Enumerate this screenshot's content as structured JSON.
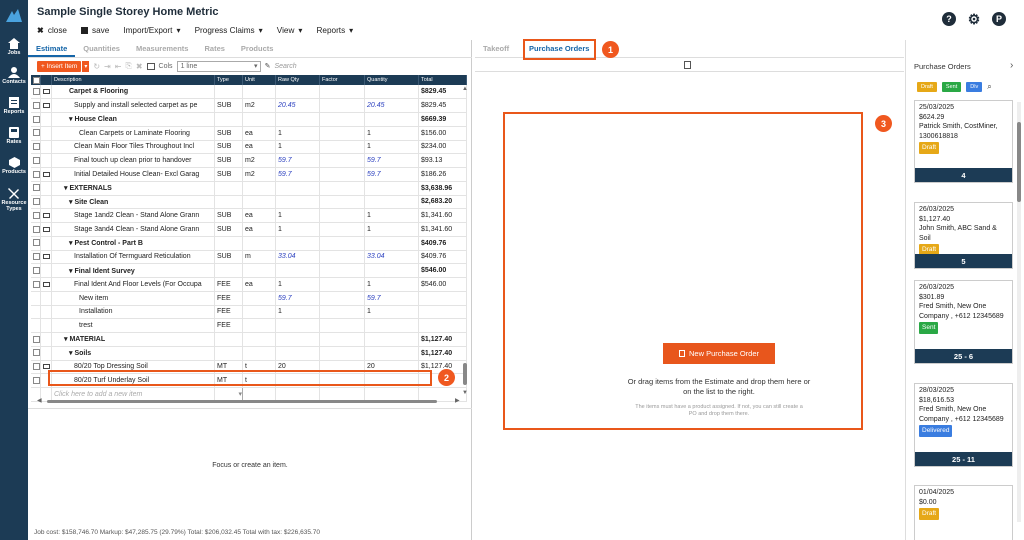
{
  "app": {
    "title": "Sample Single Storey Home Metric"
  },
  "menu": {
    "close": "close",
    "save": "save",
    "import_export": "Import/Export",
    "progress_claims": "Progress Claims",
    "view": "View",
    "reports": "Reports"
  },
  "header_icons": {
    "help": "?",
    "profile": "P"
  },
  "nav": [
    {
      "label": "Jobs",
      "icon": "home-icon"
    },
    {
      "label": "Contacts",
      "icon": "person-icon"
    },
    {
      "label": "Reports",
      "icon": "report-icon"
    },
    {
      "label": "Rates",
      "icon": "rates-icon"
    },
    {
      "label": "Products",
      "icon": "cube-icon"
    },
    {
      "label": "Resource Types",
      "icon": "tools-icon"
    }
  ],
  "left_tabs": [
    "Estimate",
    "Quantities",
    "Measurements",
    "Rates",
    "Products"
  ],
  "toolbar": {
    "insert": "+ Insert Item",
    "cols": "Cols",
    "line_select": "1 line",
    "search_placeholder": "Search"
  },
  "grid": {
    "columns": [
      "Description",
      "Type",
      "Unit",
      "Raw Qty",
      "Factor",
      "Quantity",
      "Total"
    ],
    "rows": [
      {
        "cb": true,
        "mail": true,
        "desc": "Carpet & Flooring",
        "type": "",
        "unit": "",
        "raw": "",
        "factor": "",
        "qty": "",
        "total": "$829.45",
        "bold": true,
        "ind": 3
      },
      {
        "cb": true,
        "mail": true,
        "desc": "Supply and install selected carpet as pe",
        "type": "SUB",
        "unit": "m2",
        "raw": "20.45",
        "factor": "",
        "qty": "20.45",
        "total": "$829.45",
        "ind": 4,
        "it": true
      },
      {
        "cb": true,
        "mail": false,
        "desc": "▾ House Clean",
        "type": "",
        "unit": "",
        "raw": "",
        "factor": "",
        "qty": "",
        "total": "$669.39",
        "bold": true,
        "ind": 3
      },
      {
        "cb": true,
        "mail": false,
        "desc": "Clean Carpets or Laminate Flooring",
        "type": "SUB",
        "unit": "ea",
        "raw": "1",
        "factor": "",
        "qty": "1",
        "total": "$156.00",
        "ind": 5
      },
      {
        "cb": true,
        "mail": false,
        "desc": "Clean Main Floor Tiles Throughout Incl",
        "type": "SUB",
        "unit": "ea",
        "raw": "1",
        "factor": "",
        "qty": "1",
        "total": "$234.00",
        "ind": 4
      },
      {
        "cb": true,
        "mail": false,
        "desc": "Final touch up clean prior to handover",
        "type": "SUB",
        "unit": "m2",
        "raw": "59.7",
        "factor": "",
        "qty": "59.7",
        "total": "$93.13",
        "ind": 4,
        "it": true
      },
      {
        "cb": true,
        "mail": true,
        "desc": "Initial Detailed House Clean- Excl Garag",
        "type": "SUB",
        "unit": "m2",
        "raw": "59.7",
        "factor": "",
        "qty": "59.7",
        "total": "$186.26",
        "ind": 4,
        "it": true
      },
      {
        "cb": true,
        "mail": false,
        "desc": "▾ EXTERNALS",
        "type": "",
        "unit": "",
        "raw": "",
        "factor": "",
        "qty": "",
        "total": "$3,638.96",
        "bold": true,
        "ind": 2
      },
      {
        "cb": true,
        "mail": false,
        "desc": "▾ Site Clean",
        "type": "",
        "unit": "",
        "raw": "",
        "factor": "",
        "qty": "",
        "total": "$2,683.20",
        "bold": true,
        "ind": 3
      },
      {
        "cb": true,
        "mail": true,
        "desc": "Stage 1and2 Clean - Stand Alone Grann",
        "type": "SUB",
        "unit": "ea",
        "raw": "1",
        "factor": "",
        "qty": "1",
        "total": "$1,341.60",
        "ind": 4
      },
      {
        "cb": true,
        "mail": true,
        "desc": "Stage 3and4 Clean - Stand Alone Grann",
        "type": "SUB",
        "unit": "ea",
        "raw": "1",
        "factor": "",
        "qty": "1",
        "total": "$1,341.60",
        "ind": 4
      },
      {
        "cb": true,
        "mail": false,
        "desc": "▾ Pest Control - Part B",
        "type": "",
        "unit": "",
        "raw": "",
        "factor": "",
        "qty": "",
        "total": "$409.76",
        "bold": true,
        "ind": 3
      },
      {
        "cb": true,
        "mail": true,
        "desc": "Installation Of Termguard Reticulation",
        "type": "SUB",
        "unit": "m",
        "raw": "33.04",
        "factor": "",
        "qty": "33.04",
        "total": "$409.76",
        "ind": 4,
        "it": true
      },
      {
        "cb": true,
        "mail": false,
        "desc": "▾ Final Ident Survey",
        "type": "",
        "unit": "",
        "raw": "",
        "factor": "",
        "qty": "",
        "total": "$546.00",
        "bold": true,
        "ind": 3
      },
      {
        "cb": true,
        "mail": true,
        "desc": "Final Ident And Floor Levels (For Occupa",
        "type": "FEE",
        "unit": "ea",
        "raw": "1",
        "factor": "",
        "qty": "1",
        "total": "$546.00",
        "ind": 4
      },
      {
        "cb": false,
        "mail": false,
        "desc": "New item",
        "type": "FEE",
        "unit": "",
        "raw": "59.7",
        "factor": "",
        "qty": "59.7",
        "total": "",
        "ind": 5,
        "it": true
      },
      {
        "cb": false,
        "mail": false,
        "desc": "Installation",
        "type": "FEE",
        "unit": "",
        "raw": "1",
        "factor": "",
        "qty": "1",
        "total": "",
        "ind": 5
      },
      {
        "cb": false,
        "mail": false,
        "desc": "trest",
        "type": "FEE",
        "unit": "",
        "raw": "",
        "factor": "",
        "qty": "",
        "total": "",
        "ind": 5
      },
      {
        "cb": true,
        "mail": false,
        "desc": "▾ MATERIAL",
        "type": "",
        "unit": "",
        "raw": "",
        "factor": "",
        "qty": "",
        "total": "$1,127.40",
        "bold": true,
        "ind": 2
      },
      {
        "cb": true,
        "mail": false,
        "desc": "▾ Soils",
        "type": "",
        "unit": "",
        "raw": "",
        "factor": "",
        "qty": "",
        "total": "$1,127.40",
        "bold": true,
        "ind": 3
      },
      {
        "cb": true,
        "mail": true,
        "desc": "80/20 Top Dressing Soil",
        "type": "MT",
        "unit": "t",
        "raw": "20",
        "factor": "",
        "qty": "20",
        "total": "$1,127.40",
        "ind": 4
      },
      {
        "cb": true,
        "mail": false,
        "desc": "80/20 Turf Underlay Soil",
        "type": "MT",
        "unit": "t",
        "raw": "",
        "factor": "",
        "qty": "",
        "total": "",
        "ind": 4
      }
    ],
    "add_row_placeholder": "Click here to add a new item"
  },
  "focus_text": "Focus or create an item.",
  "footer": "Job cost: $158,746.70 Markup: $47,285.75 (29.79%) Total: $206,032.45 Total with tax: $226,635.70",
  "middle": {
    "tabs": [
      "Takeoff",
      "Purchase Orders"
    ],
    "new_po": "New Purchase Order",
    "drag_text": "Or drag items from the Estimate and drop them here or on the list to the right.",
    "drag_note": "The items must have a product assigned. If not, you can still create a PO and drop them there."
  },
  "callouts": [
    "1",
    "2",
    "3"
  ],
  "right": {
    "title": "Purchase Orders",
    "filters": [
      {
        "label": "Draft",
        "color": "#e6a817"
      },
      {
        "label": "Sent",
        "color": "#2aa845"
      },
      {
        "label": "Dlv",
        "color": "#3a7de0"
      }
    ],
    "cards": [
      {
        "date": "25/03/2025",
        "amount": "$624.29",
        "who": "Patrick Smith, CostMiner, 1300618818",
        "status": "Draft",
        "status_color": "#e6a817",
        "count": "4"
      },
      {
        "date": "26/03/2025",
        "amount": "$1,127.40",
        "who": "John Smith, ABC Sand & Soil",
        "status": "Draft",
        "status_color": "#e6a817",
        "count": "5"
      },
      {
        "date": "26/03/2025",
        "amount": "$301.89",
        "who": "Fred Smith, New One Company , +612 12345689",
        "status": "Sent",
        "status_color": "#2aa845",
        "count": "25 - 6"
      },
      {
        "date": "28/03/2025",
        "amount": "$18,616.53",
        "who": "Fred Smith, New One Company , +612 12345689",
        "status": "Delivered",
        "status_color": "#3a7de0",
        "count": "25 - 11"
      },
      {
        "date": "01/04/2025",
        "amount": "$0.00",
        "who": "",
        "status": "Draft",
        "status_color": "#e6a817",
        "count": ""
      }
    ]
  }
}
